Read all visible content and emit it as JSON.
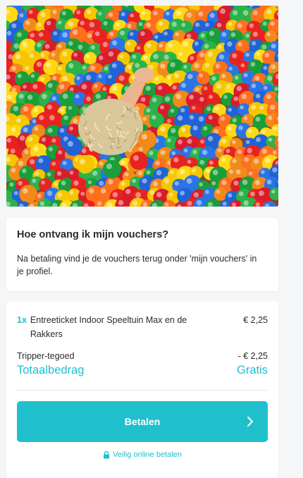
{
  "hero": {
    "image": "children-ball-pit-photo"
  },
  "info": {
    "title": "Hoe ontvang ik mijn vouchers?",
    "text": "Na betaling vind je de vouchers terug onder 'mijn vouchers' in je profiel."
  },
  "order": {
    "item_qty": "1x",
    "item_name": "Entreeticket Indoor Speeltuin Max en de Rakkers",
    "item_price": "€ 2,25",
    "credit_label": "Tripper-tegoed",
    "credit_value": "- € 2,25",
    "total_label": "Totaalbedrag",
    "total_value": "Gratis"
  },
  "payment": {
    "button_label": "Betalen",
    "button_icon": "chevron-right-icon",
    "secure_label": "Veilig online betalen",
    "secure_icon": "lock-icon"
  },
  "colors": {
    "accent": "#1fc0cc",
    "background": "#f5f6f8",
    "card": "#ffffff"
  }
}
